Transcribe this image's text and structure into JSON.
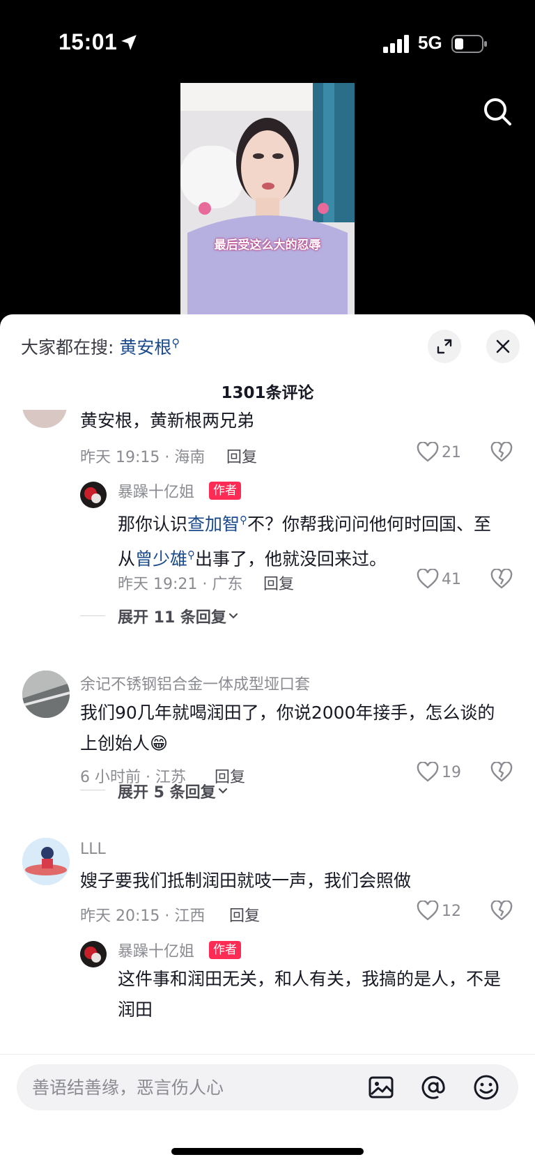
{
  "status_bar": {
    "time": "15:01",
    "network": "5G"
  },
  "video": {
    "caption": "最后受这么大的忍辱"
  },
  "sheet": {
    "hot_search_prefix": "大家都在搜:",
    "hot_search_keyword": "黄安根",
    "comment_count": "1301条评论"
  },
  "comments": {
    "c1": {
      "text": "黄安根，黄新根两兄弟",
      "time_loc": "昨天 19:15 · 海南",
      "reply_label": "回复",
      "likes": "21"
    },
    "r1": {
      "name": "暴躁十亿姐",
      "tag": "作者",
      "text_a": "那你认识",
      "link_a": "查加智",
      "text_b": "不？你帮我问问他何时回国、至从",
      "link_b": "曾少雄",
      "text_c": "出事了，他就没回来过。",
      "time_loc": "昨天 19:21 · 广东",
      "reply_label": "回复",
      "likes": "41"
    },
    "expand1": "展开 11 条回复",
    "c2": {
      "name": "余记不锈钢铝合金一体成型垭口套",
      "text": "我们90几年就喝润田了，你说2000年接手，怎么谈的上创始人😁",
      "time_loc": "6 小时前 · 江苏",
      "reply_label": "回复",
      "likes": "19"
    },
    "expand2": "展开 5 条回复",
    "c3": {
      "name": "LLL",
      "text": "嫂子要我们抵制润田就吱一声，我们会照做",
      "time_loc": "昨天 20:15 · 江西",
      "reply_label": "回复",
      "likes": "12"
    },
    "r3": {
      "name": "暴躁十亿姐",
      "tag": "作者",
      "text": "这件事和润田无关，和人有关，我搞的是人，不是润田"
    }
  },
  "input": {
    "placeholder": "善语结善缘，恶言伤人心"
  },
  "colors": {
    "accent_link": "#1a4a8c",
    "author_tag": "#fe2c55",
    "muted": "#8a8b91"
  }
}
